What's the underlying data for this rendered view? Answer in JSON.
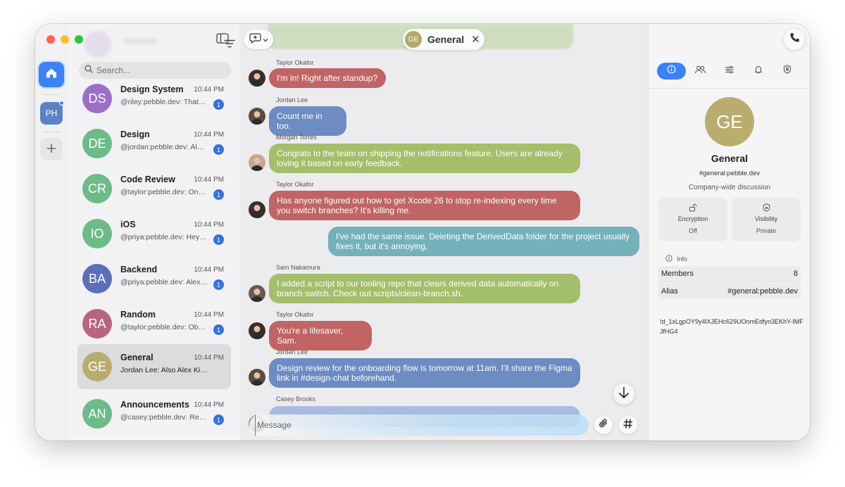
{
  "colors": {
    "accent": "#3b82f6",
    "bubble_red": "#c06464",
    "bubble_blue": "#6c8cc2",
    "bubble_green": "#a3bf6b",
    "bubble_teal": "#73b1bb"
  },
  "rail": {
    "space_initials": "PH",
    "icons": [
      "home-icon",
      "plus-icon"
    ]
  },
  "room_list": {
    "search_placeholder": "Search...",
    "icons": [
      "filter-icon",
      "sidebar-toggle-icon",
      "search-icon"
    ],
    "rooms": [
      {
        "initials": "DS",
        "name": "Design System",
        "time": "10:44 PM",
        "preview": "@riley:pebble.dev: That…",
        "unread": "1",
        "color": "#9b6fc9"
      },
      {
        "initials": "DE",
        "name": "Design",
        "time": "10:44 PM",
        "preview": "@jordan:pebble.dev: Ale…",
        "unread": "1",
        "color": "#6dbb87"
      },
      {
        "initials": "CR",
        "name": "Code Review",
        "time": "10:44 PM",
        "preview": "@taylor:pebble.dev: On…",
        "unread": "1",
        "color": "#6dbb87"
      },
      {
        "initials": "IO",
        "name": "iOS",
        "time": "10:44 PM",
        "preview": "@priya:pebble.dev: Hey…",
        "unread": "1",
        "color": "#6dbb87"
      },
      {
        "initials": "BA",
        "name": "Backend",
        "time": "10:44 PM",
        "preview": "@priya:pebble.dev: Alex…",
        "unread": "1",
        "color": "#5c6fb8"
      },
      {
        "initials": "RA",
        "name": "Random",
        "time": "10:44 PM",
        "preview": "@taylor:pebble.dev: Ob…",
        "unread": "1",
        "color": "#b8667e"
      },
      {
        "initials": "GE",
        "name": "General",
        "time": "10:44 PM",
        "preview": "Jordan Lee: Also Alex Kim, I…",
        "unread": "",
        "color": "#b9ad6e"
      },
      {
        "initials": "AN",
        "name": "Announcements",
        "time": "10:44 PM",
        "preview": "@casey:pebble.dev: Re…",
        "unread": "1",
        "color": "#6dbb87"
      }
    ]
  },
  "chat": {
    "title": "General",
    "title_initials": "GE",
    "close_glyph": "✕",
    "messages": [
      {
        "sender": "Taylor Okafor",
        "text": "I'm in! Right after standup?",
        "color": "red"
      },
      {
        "sender": "Jordan Lee",
        "text": "Count me in too.",
        "color": "blue"
      },
      {
        "sender": "Morgan Torres",
        "text": "Congrats to the team on shipping the notifications feature. Users are already loving it based on early feedback.",
        "color": "green"
      },
      {
        "sender": "Taylor Okafor",
        "text": "Has anyone figured out how to get Xcode 26 to stop re-indexing every time you switch branches? It's killing me.",
        "color": "red"
      },
      {
        "sender": "",
        "text": "I've had the same issue. Deleting the DerivedData folder for the project usually fixes it, but it's annoying.",
        "color": "teal"
      },
      {
        "sender": "Sam Nakamura",
        "text": "I added a script to our tooling repo that clears derived data automatically on branch switch. Check out scripts/clean-branch.sh.",
        "color": "green"
      },
      {
        "sender": "Taylor Okafor",
        "text": "You're a lifesaver, Sam.",
        "color": "red"
      },
      {
        "sender": "Jordan Lee",
        "text": "Design review for the onboarding flow is tomorrow at 11am. I'll share the Figma link in #design-chat beforehand.",
        "color": "blue"
      },
      {
        "sender": "Casey Brooks",
        "text": "",
        "color": "fade"
      }
    ],
    "composer_placeholder": "Message",
    "icons": [
      "compose-icon",
      "arrow-down-icon",
      "paperclip-icon",
      "hash-icon"
    ]
  },
  "info": {
    "initials": "GE",
    "name": "General",
    "alias": "#general:pebble.dev",
    "topic": "Company-wide discussion",
    "encryption_label": "Encryption",
    "encryption_value": "Off",
    "visibility_label": "Visibility",
    "visibility_value": "Private",
    "section_label": "Info",
    "members_label": "Members",
    "members_value": "8",
    "alias_label": "Alias",
    "alias_value": "#general:pebble.dev",
    "room_id": "!d_1xLgpOY9y4lXJEHc629UOnmEdfyn3EKhY-IMFJfHG4",
    "tabs": [
      "info-icon",
      "people-icon",
      "settings-sliders-icon",
      "bell-icon",
      "shield-icon"
    ]
  }
}
